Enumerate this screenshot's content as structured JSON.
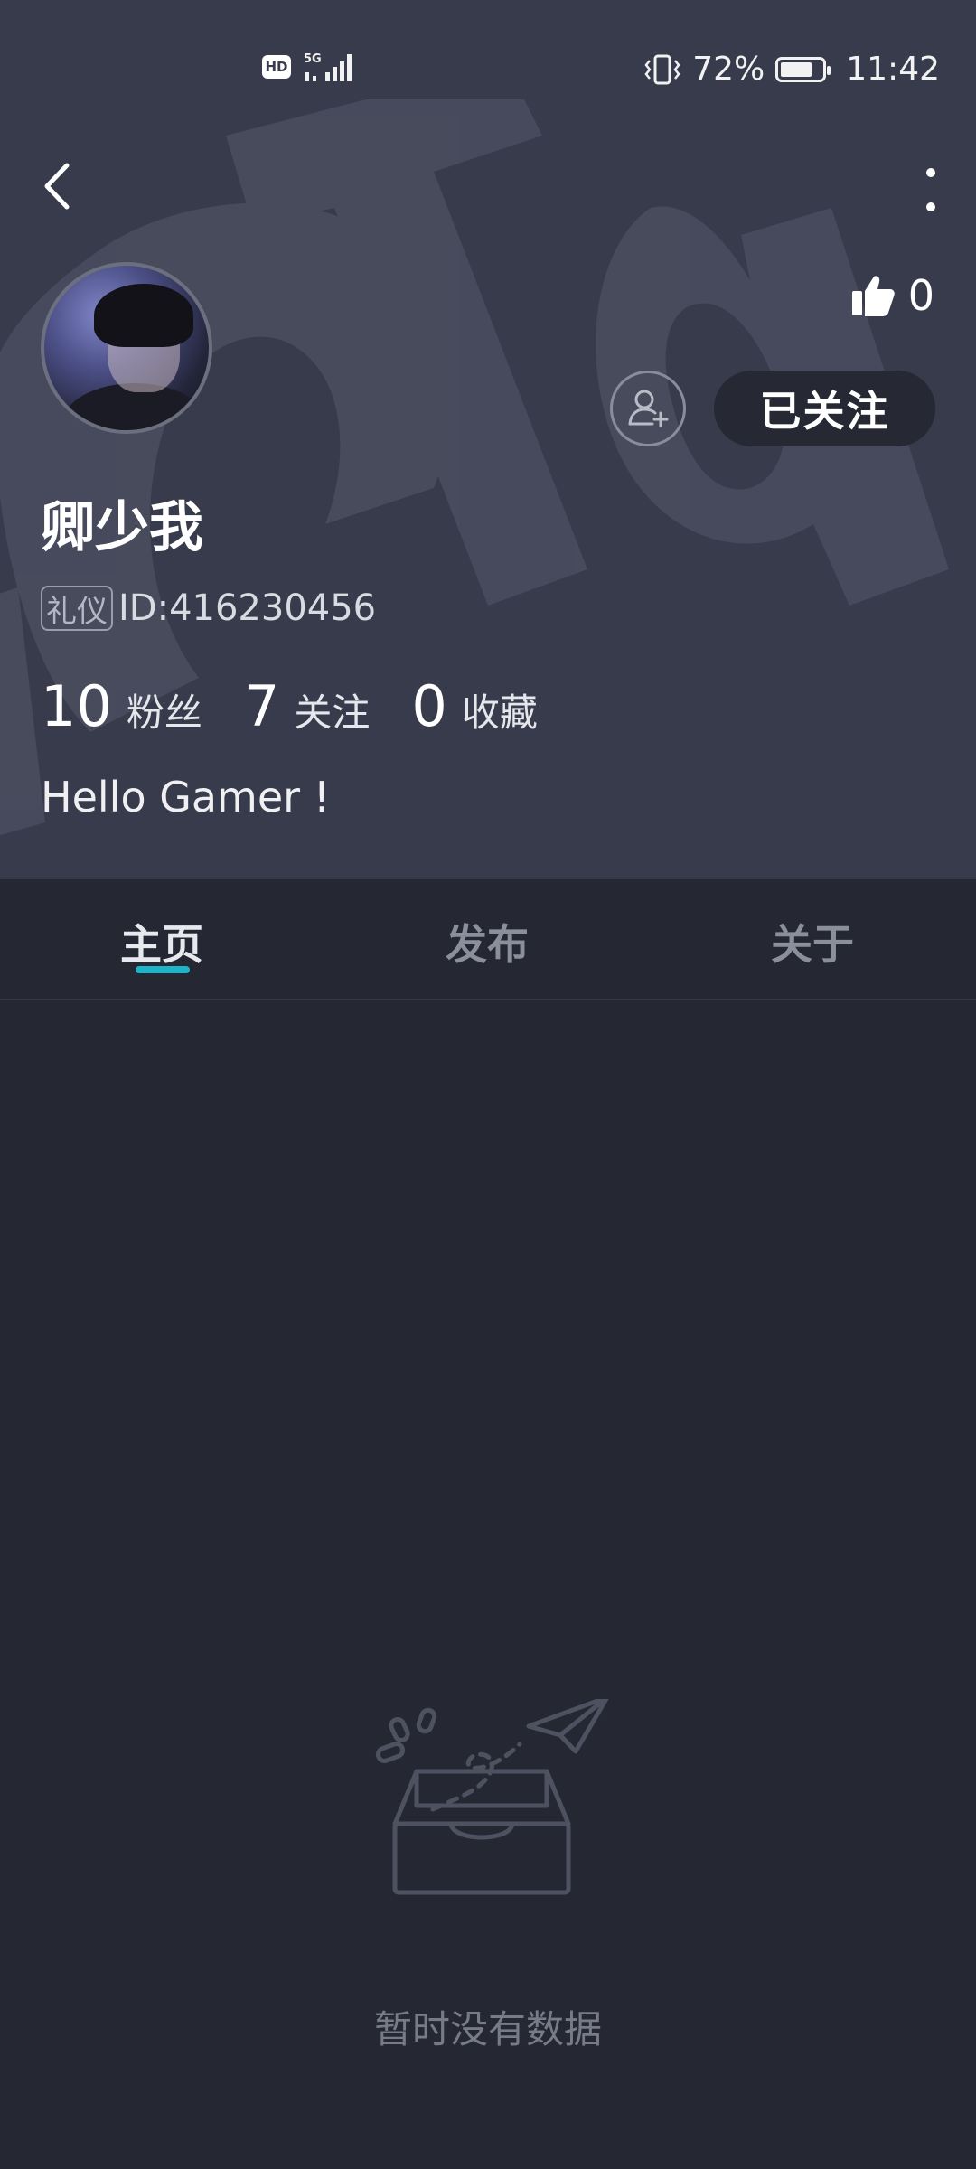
{
  "status_bar": {
    "hd": "HD",
    "network": "5G",
    "battery": "72%",
    "time": "11:42"
  },
  "profile": {
    "like_count": "0",
    "follow_button": "已关注",
    "name": "卿少我",
    "badge": "礼仪",
    "id": "ID:416230456",
    "stats": [
      {
        "value": "10",
        "label": "粉丝"
      },
      {
        "value": "7",
        "label": "关注"
      },
      {
        "value": "0",
        "label": "收藏"
      }
    ],
    "bio": "Hello Gamer !"
  },
  "tabs": [
    "主页",
    "发布",
    "关于"
  ],
  "active_tab": "主页",
  "empty_state": {
    "text": "暂时没有数据"
  },
  "colors": {
    "header_bg": "#373b4b",
    "page_bg": "#252733",
    "accent": "#1fb3c7"
  },
  "icons": [
    "back-arrow-icon",
    "more-vertical-icon",
    "thumbs-up-icon",
    "add-friend-icon",
    "empty-inbox-icon",
    "vibrate-icon",
    "signal-icon",
    "battery-icon"
  ]
}
